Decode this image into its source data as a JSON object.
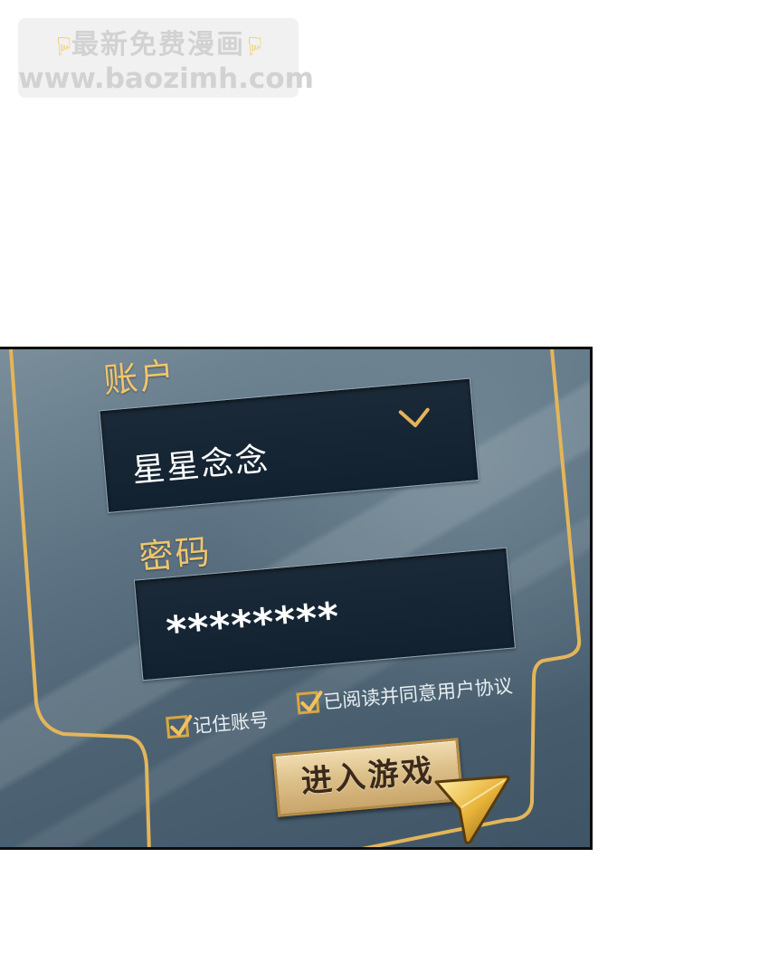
{
  "watermark": {
    "line1": "最新免费漫画",
    "line2": "www.baozimh.com",
    "icon": "pointing-down-hand-icon"
  },
  "login": {
    "account_label": "账户",
    "account_value": "星星念念",
    "password_label": "密码",
    "password_value": "********",
    "remember_label": "记住账号",
    "agree_label": "已阅读并同意用户协议",
    "enter_button": "进入游戏",
    "remember_checked": true,
    "agree_checked": true
  },
  "colors": {
    "panel": "#56707f",
    "gold": "#d9a640",
    "field": "#142232",
    "label": "#f0c56e"
  }
}
